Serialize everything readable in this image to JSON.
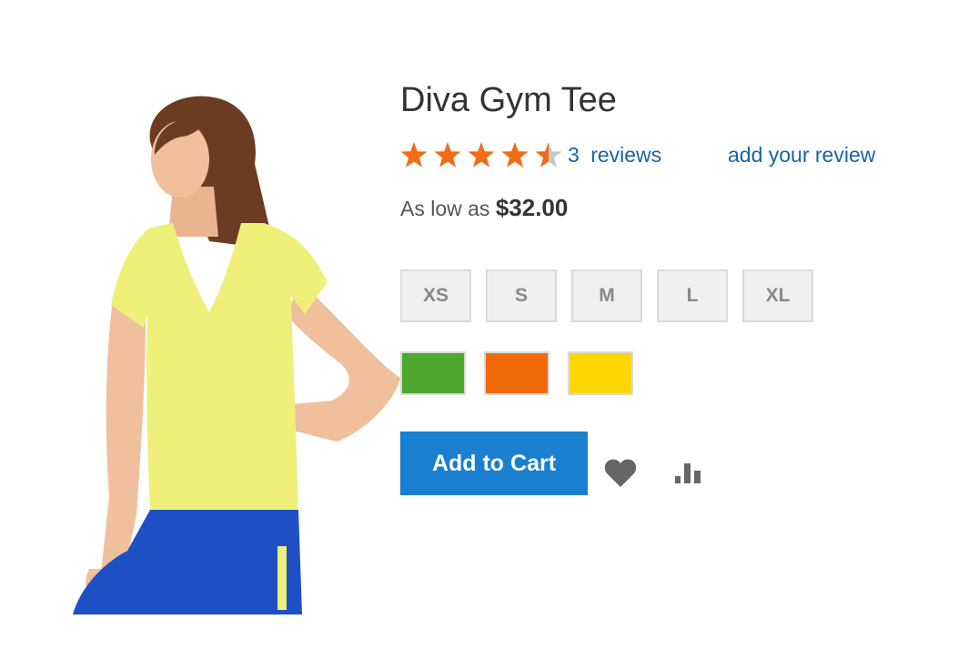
{
  "product": {
    "name": "Diva Gym Tee",
    "rating": 4.5,
    "rating_max": 5,
    "reviews_count": "3",
    "reviews_label": "reviews",
    "add_review_label": "add your review",
    "price_prefix": "As low as",
    "price": "$32.00",
    "image_alt": "woman-in-yellow-v-neck-tee",
    "image_colors": {
      "tee": "#eef07a",
      "pants": "#1f4fc4",
      "hair": "#6b3c22",
      "skin": "#f0bf9c"
    }
  },
  "options": {
    "sizes": [
      "XS",
      "S",
      "M",
      "L",
      "XL"
    ],
    "colors": [
      {
        "name": "Green",
        "hex": "#4ea82f"
      },
      {
        "name": "Orange",
        "hex": "#f06a0a"
      },
      {
        "name": "Yellow",
        "hex": "#fed700"
      }
    ]
  },
  "actions": {
    "add_to_cart_label": "Add to Cart",
    "wishlist_icon": "heart-icon",
    "compare_icon": "bar-chart-icon"
  },
  "theme": {
    "star_filled": "#f26c14",
    "star_empty": "#c8c8c8",
    "link": "#1565a8",
    "button": "#1a7fcf"
  }
}
